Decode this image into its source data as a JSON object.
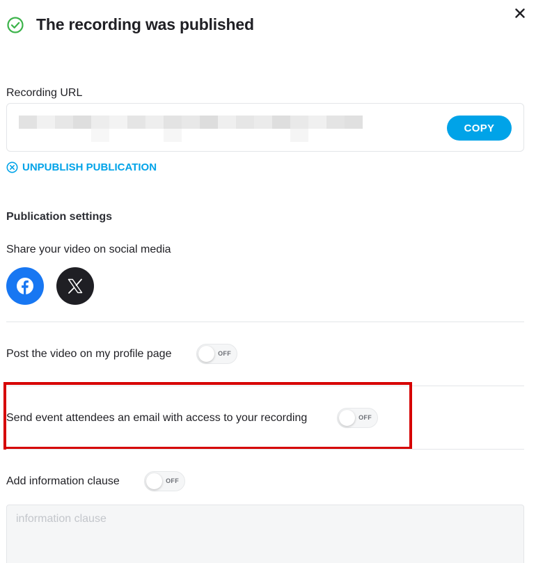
{
  "header": {
    "title": "The recording was published",
    "status_icon": "check-circle-icon",
    "close_icon": "close-icon"
  },
  "recording_url": {
    "label": "Recording URL",
    "value_hidden": true,
    "copy_label": "COPY"
  },
  "unpublish": {
    "label": "UNPUBLISH PUBLICATION",
    "icon": "circle-x-icon"
  },
  "publication_settings": {
    "title": "Publication settings",
    "share_label": "Share your video on social media",
    "social": [
      {
        "name": "facebook",
        "icon": "facebook-icon",
        "color": "#1877f2"
      },
      {
        "name": "x",
        "icon": "x-logo-icon",
        "color": "#1f1f24"
      }
    ],
    "options": [
      {
        "id": "profile",
        "label": "Post the video on my profile page",
        "toggle": "OFF"
      },
      {
        "id": "email",
        "label": "Send event attendees an email with access to your recording",
        "toggle": "OFF"
      },
      {
        "id": "clause",
        "label": "Add information clause",
        "toggle": "OFF"
      }
    ],
    "clause_placeholder": "information clause"
  },
  "colors": {
    "accent": "#00a3e8",
    "success": "#3cb34a",
    "highlight": "#d60000"
  }
}
